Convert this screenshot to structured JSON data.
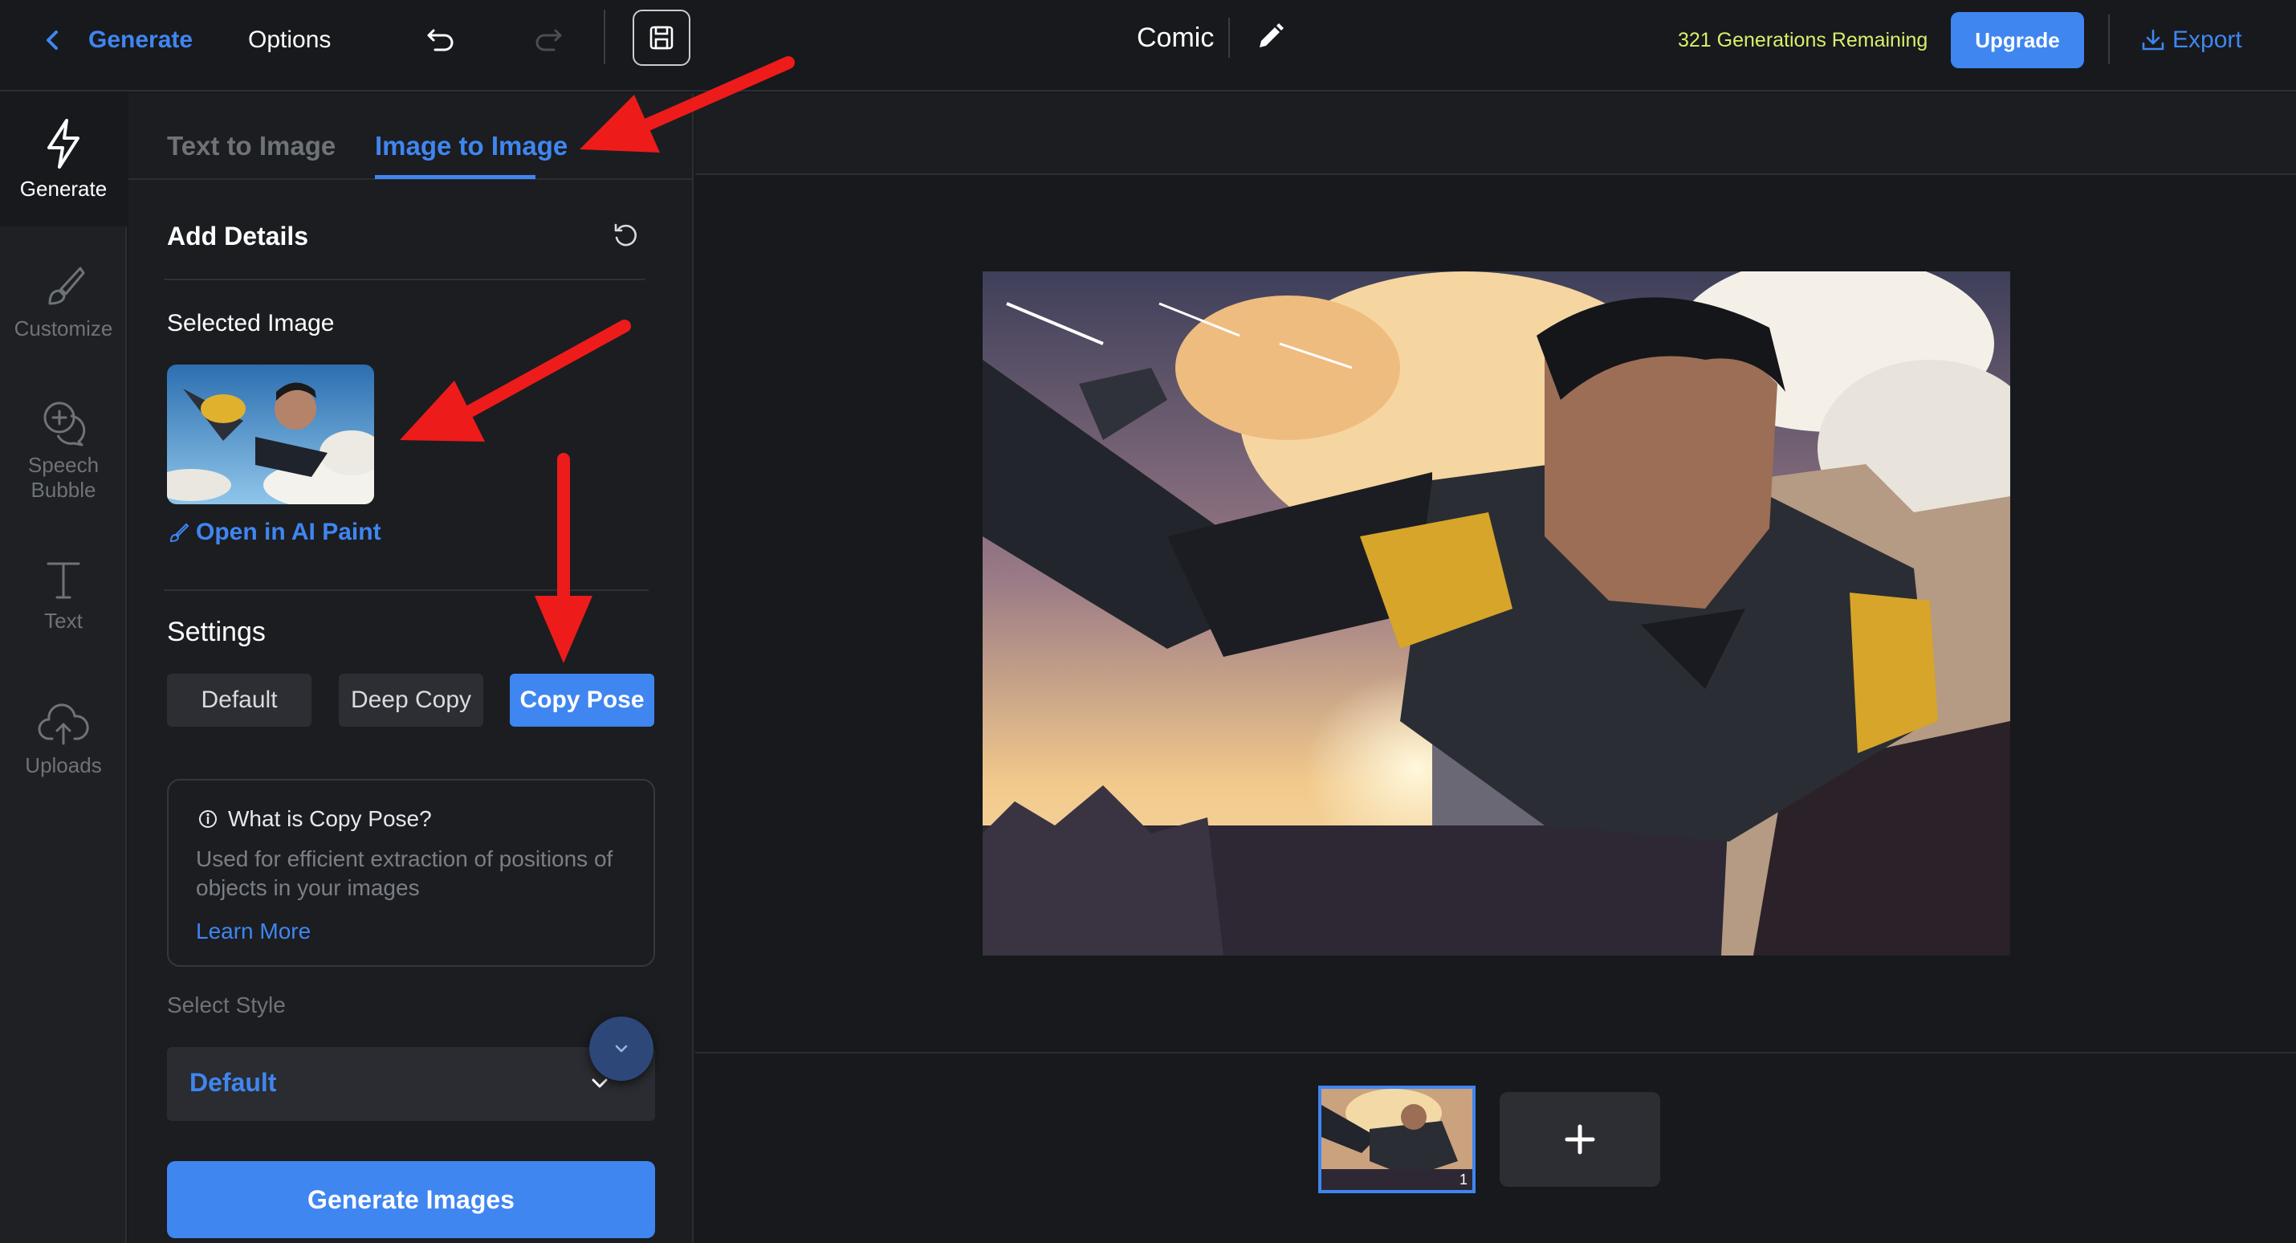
{
  "topbar": {
    "back_label": "Generate",
    "options_label": "Options",
    "project_title": "Comic",
    "generations_remaining": "321 Generations Remaining",
    "upgrade_label": "Upgrade",
    "export_label": "Export"
  },
  "rail": {
    "items": [
      {
        "label": "Generate",
        "icon": "lightning-icon",
        "active": true
      },
      {
        "label": "Customize",
        "icon": "brush-icon",
        "active": false
      },
      {
        "label": "Speech Bubble",
        "icon": "speech-bubble-icon",
        "active": false
      },
      {
        "label": "Text",
        "icon": "text-icon",
        "active": false
      },
      {
        "label": "Uploads",
        "icon": "cloud-upload-icon",
        "active": false
      }
    ]
  },
  "panel": {
    "tabs": [
      {
        "label": "Text to Image",
        "active": false
      },
      {
        "label": "Image to Image",
        "active": true
      }
    ],
    "add_details": "Add Details",
    "selected_image_label": "Selected Image",
    "open_in_ai_paint": "Open in AI Paint",
    "settings_label": "Settings",
    "settings_options": [
      "Default",
      "Deep Copy",
      "Copy Pose"
    ],
    "settings_selected": "Copy Pose",
    "info": {
      "title": "What is Copy Pose?",
      "description": "Used for efficient extraction of positions of objects in your images",
      "learn_more": "Learn More"
    },
    "style": {
      "label": "Select Style",
      "value": "Default"
    },
    "generate_button": "Generate Images"
  },
  "canvas": {
    "image_description": "comic-style superhero flying over city"
  },
  "filmstrip": {
    "frames": [
      {
        "number": "1"
      }
    ]
  },
  "colors": {
    "accent": "#3f86f0",
    "remaining_text": "#d6f06a",
    "annotation_arrow": "#ee1b1b",
    "background": "#17191d"
  }
}
